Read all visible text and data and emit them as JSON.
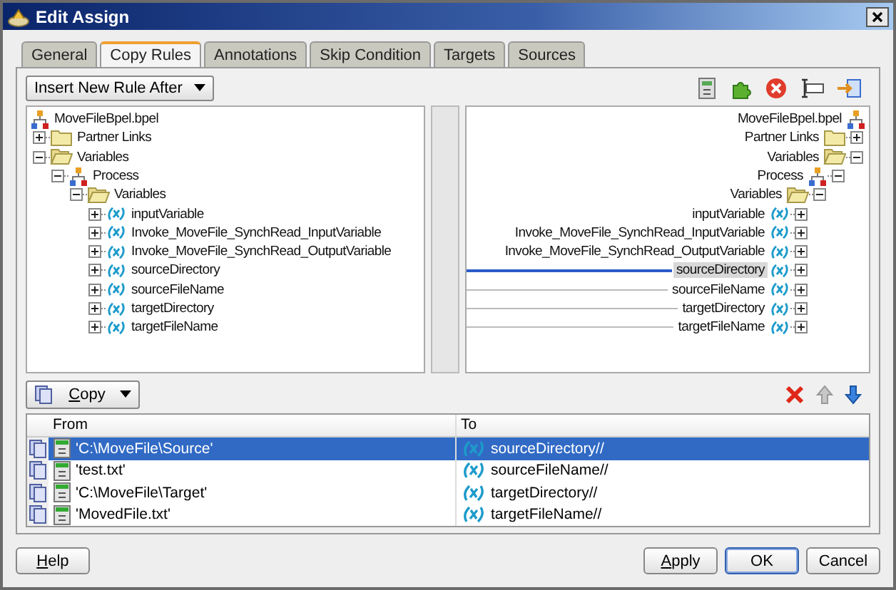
{
  "window": {
    "title": "Edit Assign"
  },
  "tabs": [
    {
      "label": "General",
      "selected": false
    },
    {
      "label": "Copy Rules",
      "selected": true
    },
    {
      "label": "Annotations",
      "selected": false
    },
    {
      "label": "Skip Condition",
      "selected": false
    },
    {
      "label": "Targets",
      "selected": false
    },
    {
      "label": "Sources",
      "selected": false
    }
  ],
  "insert_dropdown": {
    "value": "Insert New Rule After"
  },
  "source_tree": {
    "root": {
      "label": "MoveFileBpel.bpel",
      "kind": "bpel"
    },
    "children": [
      {
        "label": "Partner Links",
        "kind": "folder",
        "expanded": false
      },
      {
        "label": "Variables",
        "kind": "folder",
        "expanded": true,
        "children": [
          {
            "label": "Process",
            "kind": "process",
            "expanded": true,
            "children": [
              {
                "label": "Variables",
                "kind": "folder",
                "expanded": true,
                "children": [
                  {
                    "label": "inputVariable",
                    "kind": "variable",
                    "expanded": false
                  },
                  {
                    "label": "Invoke_MoveFile_SynchRead_InputVariable",
                    "kind": "variable",
                    "expanded": false
                  },
                  {
                    "label": "Invoke_MoveFile_SynchRead_OutputVariable",
                    "kind": "variable",
                    "expanded": false
                  },
                  {
                    "label": "sourceDirectory",
                    "kind": "variable",
                    "expanded": false
                  },
                  {
                    "label": "sourceFileName",
                    "kind": "variable",
                    "expanded": false
                  },
                  {
                    "label": "targetDirectory",
                    "kind": "variable",
                    "expanded": false
                  },
                  {
                    "label": "targetFileName",
                    "kind": "variable",
                    "expanded": false
                  }
                ]
              }
            ]
          }
        ]
      }
    ]
  },
  "target_tree": {
    "root": {
      "label": "MoveFileBpel.bpel",
      "kind": "bpel",
      "selected": false
    },
    "children": [
      {
        "label": "Partner Links",
        "kind": "folder",
        "expanded": false,
        "selected": false
      },
      {
        "label": "Variables",
        "kind": "folder",
        "expanded": true,
        "selected": false,
        "children": [
          {
            "label": "Process",
            "kind": "process",
            "expanded": true,
            "selected": false,
            "children": [
              {
                "label": "Variables",
                "kind": "folder",
                "expanded": true,
                "selected": false,
                "children": [
                  {
                    "label": "inputVariable",
                    "kind": "variable",
                    "expanded": false,
                    "selected": false,
                    "mapped": false
                  },
                  {
                    "label": "Invoke_MoveFile_SynchRead_InputVariable",
                    "kind": "variable",
                    "expanded": false,
                    "selected": false,
                    "mapped": false
                  },
                  {
                    "label": "Invoke_MoveFile_SynchRead_OutputVariable",
                    "kind": "variable",
                    "expanded": false,
                    "selected": false,
                    "mapped": false
                  },
                  {
                    "label": "sourceDirectory",
                    "kind": "variable",
                    "expanded": false,
                    "selected": true,
                    "mapped": true
                  },
                  {
                    "label": "sourceFileName",
                    "kind": "variable",
                    "expanded": false,
                    "selected": false,
                    "mapped": true
                  },
                  {
                    "label": "targetDirectory",
                    "kind": "variable",
                    "expanded": false,
                    "selected": false,
                    "mapped": true
                  },
                  {
                    "label": "targetFileName",
                    "kind": "variable",
                    "expanded": false,
                    "selected": false,
                    "mapped": true
                  }
                ]
              }
            ]
          }
        ]
      }
    ]
  },
  "operation_dropdown": {
    "value": "Copy"
  },
  "table": {
    "columns": [
      "From",
      "To"
    ],
    "rows": [
      {
        "from": "'C:\\MoveFile\\Source'",
        "to": "sourceDirectory//",
        "selected": true
      },
      {
        "from": "'test.txt'",
        "to": "sourceFileName//",
        "selected": false
      },
      {
        "from": "'C:\\MoveFile\\Target'",
        "to": "targetDirectory//",
        "selected": false
      },
      {
        "from": "'MovedFile.txt'",
        "to": "targetFileName//",
        "selected": false
      }
    ]
  },
  "help_button": {
    "label": "Help"
  },
  "buttons": [
    {
      "label": "Apply",
      "default": false
    },
    {
      "label": "OK",
      "default": true
    },
    {
      "label": "Cancel",
      "default": false
    }
  ]
}
